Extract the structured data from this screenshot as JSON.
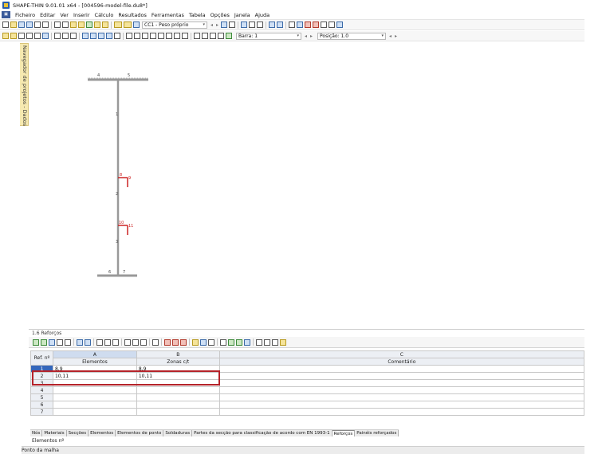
{
  "window": {
    "title": "SHAPE-THIN 9.01.01 x64 - [004596-model-file.du8*]"
  },
  "menu": {
    "items": [
      {
        "label": "Ficheiro"
      },
      {
        "label": "Editar"
      },
      {
        "label": "Ver"
      },
      {
        "label": "Inserir"
      },
      {
        "label": "Cálculo"
      },
      {
        "label": "Resultados"
      },
      {
        "label": "Ferramentas"
      },
      {
        "label": "Tabela"
      },
      {
        "label": "Opções"
      },
      {
        "label": "Janela"
      },
      {
        "label": "Ajuda"
      }
    ]
  },
  "toolbar": {
    "load_case": "CC1 - Peso próprio",
    "bar_select": "Barra: 1",
    "position_select": "Posição: 1.0"
  },
  "navigator": {
    "label": "Navegador de projetos - Dados"
  },
  "drawing": {
    "node_labels": {
      "n4": "4",
      "n5": "5",
      "n6": "6",
      "n7": "7",
      "n8": "8",
      "n9": "9",
      "n10": "10",
      "n11": "11"
    },
    "member_labels": {
      "m1": "1",
      "m2": "2",
      "m3": "3"
    }
  },
  "panel": {
    "title": "1.6 Reforços"
  },
  "table": {
    "col_letters": [
      "A",
      "B",
      "C"
    ],
    "corner_label": "Ref. nº",
    "headers": [
      "Elementos",
      "Zonas c/t",
      "Comentário"
    ],
    "rows": [
      {
        "no": "1",
        "elementos": "8,9",
        "zonas": "8,9",
        "comentario": ""
      },
      {
        "no": "2",
        "elementos": "10,11",
        "zonas": "10,11",
        "comentario": ""
      },
      {
        "no": "3",
        "elementos": "",
        "zonas": "",
        "comentario": ""
      },
      {
        "no": "4",
        "elementos": "",
        "zonas": "",
        "comentario": ""
      },
      {
        "no": "5",
        "elementos": "",
        "zonas": "",
        "comentario": ""
      },
      {
        "no": "6",
        "elementos": "",
        "zonas": "",
        "comentario": ""
      },
      {
        "no": "7",
        "elementos": "",
        "zonas": "",
        "comentario": ""
      }
    ]
  },
  "tabs": [
    {
      "label": "Nós",
      "active": false
    },
    {
      "label": "Materiais",
      "active": false
    },
    {
      "label": "Secções",
      "active": false
    },
    {
      "label": "Elementos",
      "active": false
    },
    {
      "label": "Elementos de ponto",
      "active": false
    },
    {
      "label": "Soldaduras",
      "active": false
    },
    {
      "label": "Partes da secção para classificação de acordo com EN 1993-1",
      "active": false
    },
    {
      "label": "Reforços",
      "active": true
    },
    {
      "label": "Painéis reforçados",
      "active": false
    }
  ],
  "field_label": "Elementos nº",
  "status": {
    "text": "Ponto da malha"
  },
  "colors": {
    "accent": "#3466bb",
    "highlight": "#b5232a",
    "stiffener": "#cc2222",
    "navigator": "#f6e9b0"
  }
}
